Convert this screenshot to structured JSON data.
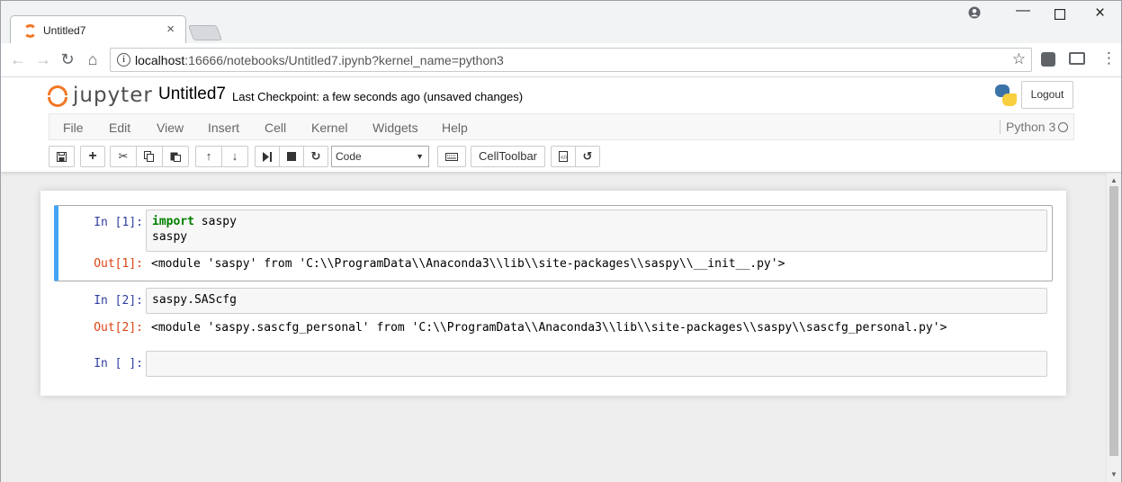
{
  "browser": {
    "tab_title": "Untitled7",
    "url_host": "localhost",
    "url_rest": ":16666/notebooks/Untitled7.ipynb?kernel_name=python3"
  },
  "jupyter": {
    "logo_text": "jupyter",
    "notebook_title": "Untitled7",
    "checkpoint": "Last Checkpoint: a few seconds ago (unsaved changes)",
    "logout_label": "Logout",
    "menu": [
      "File",
      "Edit",
      "View",
      "Insert",
      "Cell",
      "Kernel",
      "Widgets",
      "Help"
    ],
    "kernel_name": "Python 3",
    "celltype": "Code",
    "celltoolbar_label": "CellToolbar"
  },
  "cells": [
    {
      "in_prompt": "In [1]:",
      "code_keyword": "import",
      "code_line1_rest": " saspy",
      "code_line2": "saspy",
      "out_prompt": "Out[1]:",
      "output": "<module 'saspy' from 'C:\\\\ProgramData\\\\Anaconda3\\\\lib\\\\site-packages\\\\saspy\\\\__init__.py'>"
    },
    {
      "in_prompt": "In [2]:",
      "code": "saspy.SAScfg",
      "out_prompt": "Out[2]:",
      "output": "<module 'saspy.sascfg_personal' from 'C:\\\\ProgramData\\\\Anaconda3\\\\lib\\\\site-packages\\\\saspy\\\\sascfg_personal.py'>"
    },
    {
      "in_prompt": "In [ ]:",
      "code": ""
    }
  ],
  "icons": {
    "tab_favicon": "jupyter-icon",
    "tab_close": "close-icon",
    "account": "account-icon",
    "minimize": "minimize-icon",
    "maximize": "maximize-icon",
    "close_window": "close-icon",
    "back": "arrow-left-icon",
    "forward": "arrow-right-icon",
    "reload": "reload-icon",
    "home": "home-icon",
    "info": "info-icon",
    "bookmark": "star-icon",
    "cast": "cast-icon",
    "menu": "more-vertical-icon",
    "toolbar": [
      "save-icon",
      "plus-icon",
      "cut-icon",
      "copy-icon",
      "paste-icon",
      "arrow-up-icon",
      "arrow-down-icon",
      "step-forward-icon",
      "stop-icon",
      "restart-icon",
      "keyboard-icon",
      "presentation-icon",
      "history-icon"
    ]
  },
  "colors": {
    "jupyter_orange": "#f37726",
    "selected_cell": "#42a5f5",
    "in_prompt": "#303f9f",
    "out_prompt": "#d84315",
    "keyword": "#008000"
  }
}
